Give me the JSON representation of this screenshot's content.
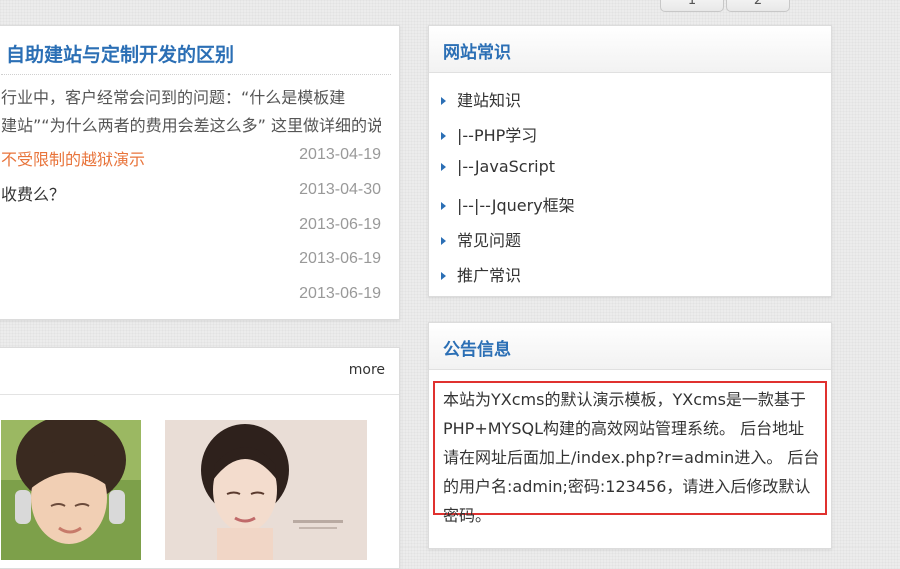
{
  "pagination": {
    "pages": [
      "1",
      "2"
    ]
  },
  "article": {
    "title": "自助建站与定制开发的区别",
    "summary_lines": [
      "行业中，客户经常会问到的问题：“什么是模板建",
      "建站”“为什么两者的费用会差这么多” 这里做详细的说"
    ]
  },
  "news": [
    {
      "title": "不受限制的越狱演示",
      "date": "2013-04-19",
      "highlight": true
    },
    {
      "title": "收费么？",
      "date": "2013-04-30",
      "highlight": false
    },
    {
      "title": "",
      "date": "2013-06-19",
      "highlight": false
    },
    {
      "title": "",
      "date": "2013-06-19",
      "highlight": false
    },
    {
      "title": "",
      "date": "2013-06-19",
      "highlight": false
    }
  ],
  "gallery": {
    "more_label": "more"
  },
  "site_knowledge": {
    "title": "网站常识",
    "items": [
      "建站知识",
      "|--PHP学习",
      "|--JavaScript",
      "|--|--Jquery框架",
      "常见问题",
      "推广常识"
    ]
  },
  "notice": {
    "title": "公告信息",
    "lines": [
      "本站为YXcms的默认演示模板，YXcms是一款基于",
      "PHP+MYSQL构建的高效网站管理系统。 后台地址",
      "请在网址后面加上/index.php?r=admin进入。 后台",
      "的用户名:admin;密码:123456，请进入后修改默认",
      "密码。"
    ]
  },
  "colors": {
    "accent": "#2b6fb5",
    "highlight": "#e8743b",
    "callout_border": "#e0312f"
  }
}
